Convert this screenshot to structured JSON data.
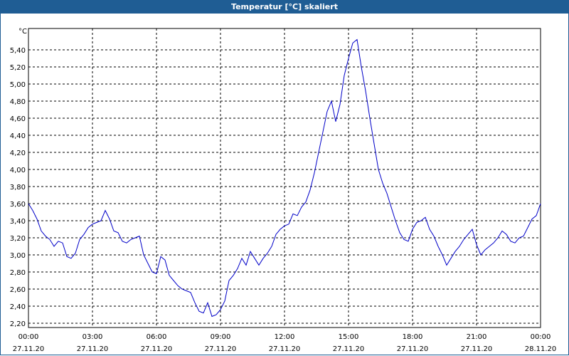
{
  "window": {
    "title": "Temperatur [°C] skaliert"
  },
  "chart_data": {
    "type": "line",
    "title": "Temperatur [°C] skaliert",
    "ylabel": "°C",
    "xlabel": "",
    "ylim": [
      2.15,
      5.65
    ],
    "yticks": [
      "2,20",
      "2,40",
      "2,60",
      "2,80",
      "3,00",
      "3,20",
      "3,40",
      "3,60",
      "3,80",
      "4,00",
      "4,20",
      "4,40",
      "4,60",
      "4,80",
      "5,00",
      "5,20",
      "5,40"
    ],
    "ytick_values": [
      2.2,
      2.4,
      2.6,
      2.8,
      3.0,
      3.2,
      3.4,
      3.6,
      3.8,
      4.0,
      4.2,
      4.4,
      4.6,
      4.8,
      5.0,
      5.2,
      5.4
    ],
    "xticks": [
      {
        "time": "00:00",
        "date": "27.11.20",
        "hour": 0
      },
      {
        "time": "03:00",
        "date": "27.11.20",
        "hour": 3
      },
      {
        "time": "06:00",
        "date": "27.11.20",
        "hour": 6
      },
      {
        "time": "09:00",
        "date": "27.11.20",
        "hour": 9
      },
      {
        "time": "12:00",
        "date": "27.11.20",
        "hour": 12
      },
      {
        "time": "15:00",
        "date": "27.11.20",
        "hour": 15
      },
      {
        "time": "18:00",
        "date": "27.11.20",
        "hour": 18
      },
      {
        "time": "21:00",
        "date": "27.11.20",
        "hour": 21
      },
      {
        "time": "00:00",
        "date": "28.11.20",
        "hour": 24
      }
    ],
    "grid": true,
    "line_color": "#0000c8",
    "series": [
      {
        "x": [
          0,
          0.2,
          0.4,
          0.6,
          0.8,
          1.0,
          1.2,
          1.4,
          1.6,
          1.8,
          2.0,
          2.2,
          2.4,
          2.6,
          2.8,
          3.0,
          3.2,
          3.4,
          3.6,
          3.8,
          4.0,
          4.2,
          4.4,
          4.6,
          4.8,
          5.0,
          5.2,
          5.4,
          5.6,
          5.8,
          6.0,
          6.2,
          6.4,
          6.6,
          6.8,
          7.0,
          7.2,
          7.4,
          7.6,
          7.8,
          8.0,
          8.2,
          8.4,
          8.6,
          8.8,
          9.0,
          9.2,
          9.4,
          9.6,
          9.8,
          10.0,
          10.2,
          10.4,
          10.6,
          10.8,
          11.0,
          11.2,
          11.4,
          11.6,
          11.8,
          12.0,
          12.2,
          12.4,
          12.6,
          12.8,
          13.0,
          13.2,
          13.4,
          13.6,
          13.8,
          14.0,
          14.2,
          14.4,
          14.6,
          14.8,
          15.0,
          15.2,
          15.4,
          15.6,
          15.8,
          16.0,
          16.2,
          16.4,
          16.6,
          16.8,
          17.0,
          17.2,
          17.4,
          17.6,
          17.8,
          18.0,
          18.2,
          18.4,
          18.6,
          18.8,
          19.0,
          19.2,
          19.4,
          19.6,
          19.8,
          20.0,
          20.2,
          20.4,
          20.6,
          20.8,
          21.0,
          21.2,
          21.4,
          21.6,
          21.8,
          22.0,
          22.2,
          22.4,
          22.6,
          22.8,
          23.0,
          23.2,
          23.4,
          23.6,
          23.8,
          24.0
        ],
        "y": [
          3.6,
          3.52,
          3.42,
          3.28,
          3.22,
          3.18,
          3.1,
          3.16,
          3.14,
          2.98,
          2.96,
          3.02,
          3.18,
          3.24,
          3.32,
          3.36,
          3.38,
          3.4,
          3.52,
          3.42,
          3.28,
          3.26,
          3.16,
          3.14,
          3.18,
          3.2,
          3.22,
          3.0,
          2.9,
          2.8,
          2.78,
          2.98,
          2.94,
          2.76,
          2.7,
          2.64,
          2.6,
          2.58,
          2.56,
          2.44,
          2.34,
          2.32,
          2.44,
          2.28,
          2.3,
          2.36,
          2.46,
          2.7,
          2.76,
          2.84,
          2.96,
          2.88,
          3.04,
          2.96,
          2.88,
          2.96,
          3.02,
          3.1,
          3.24,
          3.3,
          3.34,
          3.36,
          3.48,
          3.46,
          3.56,
          3.62,
          3.76,
          3.96,
          4.2,
          4.44,
          4.68,
          4.8,
          4.56,
          4.76,
          5.1,
          5.3,
          5.48,
          5.52,
          5.2,
          4.92,
          4.6,
          4.3,
          4.0,
          3.84,
          3.72,
          3.56,
          3.4,
          3.26,
          3.18,
          3.16,
          3.3,
          3.38,
          3.4,
          3.44,
          3.3,
          3.22,
          3.1,
          3.0,
          2.88,
          2.96,
          3.04,
          3.1,
          3.18,
          3.24,
          3.3,
          3.12,
          3.0,
          3.06,
          3.1,
          3.14,
          3.2,
          3.28,
          3.24,
          3.16,
          3.14,
          3.2,
          3.22,
          3.32,
          3.42,
          3.46,
          3.6
        ]
      }
    ]
  }
}
